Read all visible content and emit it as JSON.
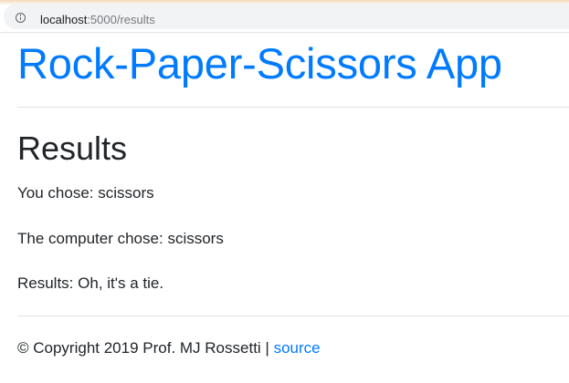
{
  "browser": {
    "url_host": "localhost",
    "url_rest": ":5000/results",
    "info_icon": "info-icon"
  },
  "header": {
    "app_title": "Rock-Paper-Scissors App"
  },
  "main": {
    "heading": "Results",
    "user_choice_label": "You chose:",
    "user_choice": "scissors",
    "computer_choice_label": "The computer chose:",
    "computer_choice": "scissors",
    "result_label": "Results:",
    "result": "Oh, it's a tie."
  },
  "footer": {
    "copyright": "© Copyright 2019 Prof. MJ Rossetti",
    "separator": "|",
    "source_link": "source"
  },
  "colors": {
    "link": "#007bff",
    "text": "#212529"
  }
}
